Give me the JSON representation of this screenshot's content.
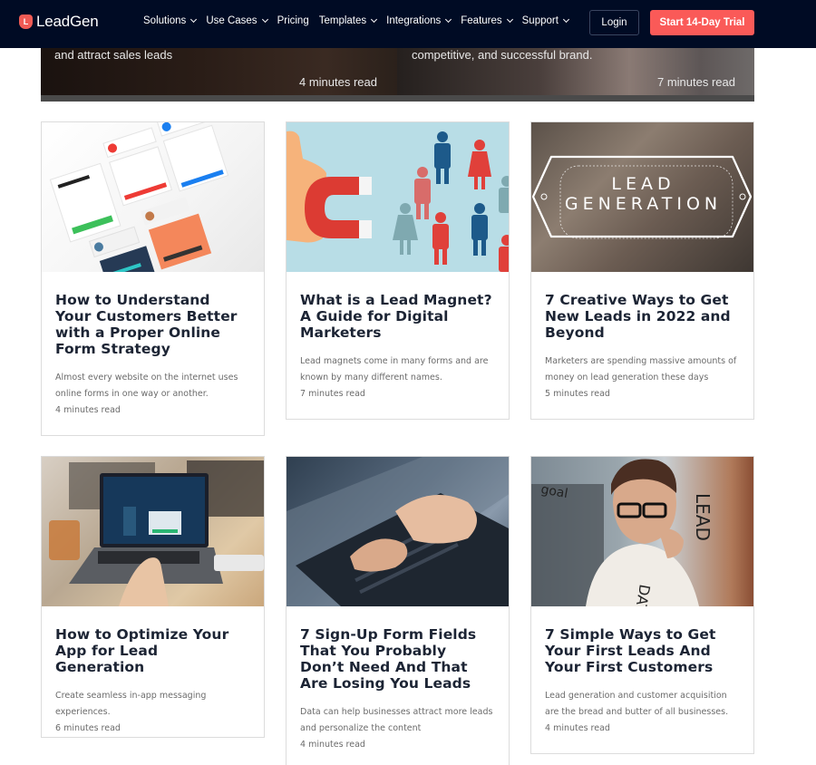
{
  "nav": {
    "logo_mark": "L",
    "logo_text": "LeadGen",
    "menu": [
      {
        "label": "Solutions",
        "has_dropdown": true
      },
      {
        "label": "Use Cases",
        "has_dropdown": true
      },
      {
        "label": "Pricing",
        "has_dropdown": false
      },
      {
        "label": "Templates",
        "has_dropdown": true
      },
      {
        "label": "Integrations",
        "has_dropdown": true
      },
      {
        "label": "Features",
        "has_dropdown": true
      },
      {
        "label": "Support",
        "has_dropdown": true
      }
    ],
    "login_label": "Login",
    "trial_label": "Start 14-Day Trial",
    "colors": {
      "background": "#000b24",
      "accent": "#fa5a58"
    }
  },
  "hero": {
    "left": {
      "excerpt": "and attract sales leads",
      "read_time": "4 minutes read"
    },
    "right": {
      "excerpt": "competitive, and successful brand.",
      "read_time": "7 minutes read"
    }
  },
  "articles": [
    {
      "image": "online-forms-collage",
      "title": "How to Understand Your Customers Better with a Proper Online Form Strategy",
      "description": "Almost every website on the internet uses online forms in one way or another.",
      "read_time": "4 minutes read"
    },
    {
      "image": "magnet-attracting-people",
      "title": "What is a Lead Magnet? A Guide for Digital Marketers",
      "description": "Lead magnets come in many forms and are known by many different names.",
      "read_time": "7 minutes read"
    },
    {
      "image": "lead-generation-meeting",
      "image_caption_line1": "LEAD",
      "image_caption_line2": "GENERATION",
      "title": "7 Creative Ways to Get New Leads in 2022 and Beyond",
      "description": "Marketers are spending massive amounts of money on lead generation these days",
      "read_time": "5 minutes read"
    },
    {
      "image": "laptop-app-screen",
      "title": "How to Optimize Your App for Lead Generation",
      "description": "Create seamless in-app messaging experiences.",
      "read_time": "6 minutes read"
    },
    {
      "image": "hands-typing-laptop",
      "title": "7 Sign-Up Form Fields That You Probably Don’t Need And That Are Losing You Leads",
      "description": "Data can help businesses attract more leads and personalize the content",
      "read_time": "4 minutes read"
    },
    {
      "image": "man-writing-on-glass",
      "title": "7 Simple Ways to Get Your First Leads And Your First Customers",
      "description": "Lead generation and customer acquisition are the bread and butter of all businesses.",
      "read_time": "4 minutes read"
    }
  ]
}
